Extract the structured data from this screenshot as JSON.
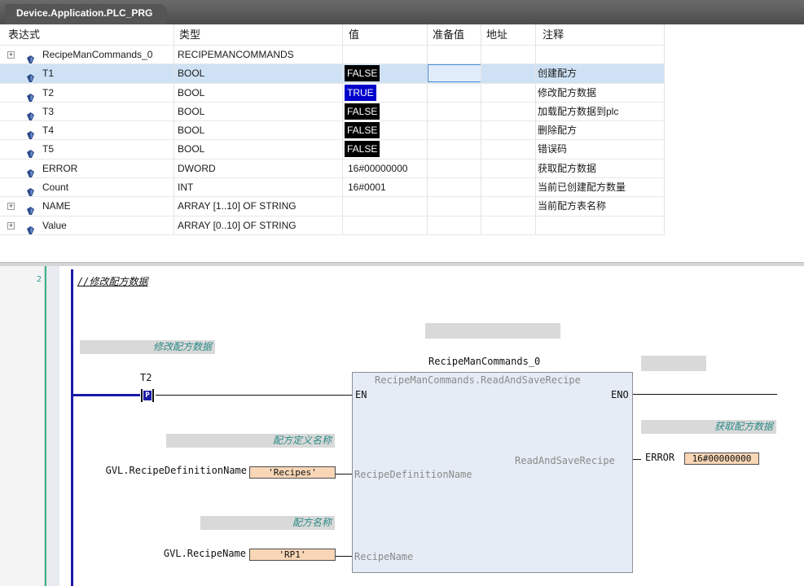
{
  "window": {
    "tab_title": "Device.Application.PLC_PRG"
  },
  "watch": {
    "columns": {
      "expression": "表达式",
      "type": "类型",
      "value": "值",
      "prepared": "准备值",
      "address": "地址",
      "comment": "注释"
    },
    "rows": [
      {
        "name": "RecipeManCommands_0",
        "type": "RECIPEMANCOMMANDS",
        "value": "",
        "comment": "",
        "expandable": true,
        "value_style": "plain"
      },
      {
        "name": "T1",
        "type": "BOOL",
        "value": "FALSE",
        "comment": "创建配方",
        "expandable": false,
        "value_style": "false",
        "selected": true
      },
      {
        "name": "T2",
        "type": "BOOL",
        "value": "TRUE",
        "comment": "修改配方数据",
        "expandable": false,
        "value_style": "true"
      },
      {
        "name": "T3",
        "type": "BOOL",
        "value": "FALSE",
        "comment": "加载配方数据到plc",
        "expandable": false,
        "value_style": "false"
      },
      {
        "name": "T4",
        "type": "BOOL",
        "value": "FALSE",
        "comment": "删除配方",
        "expandable": false,
        "value_style": "false"
      },
      {
        "name": "T5",
        "type": "BOOL",
        "value": "FALSE",
        "comment": "错误码",
        "expandable": false,
        "value_style": "false"
      },
      {
        "name": "ERROR",
        "type": "DWORD",
        "value": "16#00000000",
        "comment": "获取配方数据",
        "expandable": false,
        "value_style": "plain"
      },
      {
        "name": "Count",
        "type": "INT",
        "value": "16#0001",
        "comment": "当前已创建配方数量",
        "expandable": false,
        "value_style": "plain"
      },
      {
        "name": "NAME",
        "type": "ARRAY [1..10] OF STRING",
        "value": "",
        "comment": "当前配方表名称",
        "expandable": true,
        "value_style": "plain"
      },
      {
        "name": "Value",
        "type": "ARRAY [0..10] OF STRING",
        "value": "",
        "comment": "",
        "expandable": true,
        "value_style": "plain"
      }
    ]
  },
  "editor": {
    "line_number": "2",
    "network_comment": "//修改配方数据",
    "label_modify": "修改配方数据",
    "label_get": "获取配方数据",
    "label_def_name": "配方定义名称",
    "label_recipe_name": "配方名称",
    "contact": {
      "name": "T2",
      "glyph": "P"
    },
    "fb": {
      "instance": "RecipeManCommands_0",
      "type": "RecipeManCommands.ReadAndSaveRecipe",
      "pin_en": "EN",
      "pin_eno": "ENO",
      "pin_out": "ReadAndSaveRecipe",
      "pin_in1": "RecipeDefinitionName",
      "pin_in2": "RecipeName"
    },
    "output": {
      "name": "ERROR",
      "value": "16#00000000"
    },
    "input1": {
      "name": "GVL.RecipeDefinitionName",
      "value": "'Recipes'"
    },
    "input2": {
      "name": "GVL.RecipeName",
      "value": "'RP1'"
    }
  },
  "colors": {
    "selected_row": "#cfe2f5",
    "true_value": "#0000cc",
    "false_value": "#000000",
    "rail": "#1a1aa8",
    "fb_fill": "#e6ecf5",
    "io_value_fill": "#f8d6b6"
  }
}
